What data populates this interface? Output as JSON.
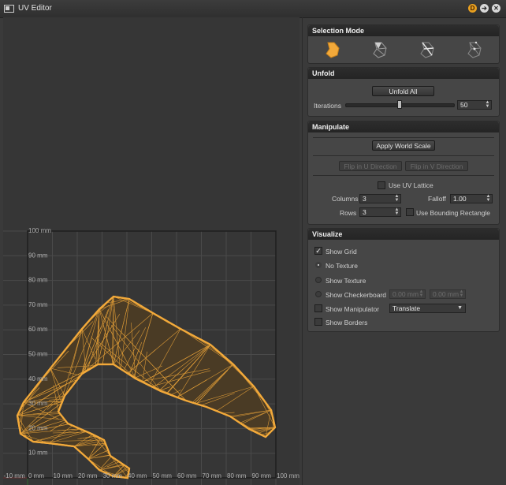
{
  "window": {
    "title": "UV Editor"
  },
  "viewport": {
    "unit": "mm",
    "y_labels": [
      "100 mm",
      "90 mm",
      "80 mm",
      "70 mm",
      "60 mm",
      "50 mm",
      "40 mm",
      "30 mm",
      "20 mm",
      "10 mm"
    ],
    "x_labels": [
      "-10 mm",
      "0 mm",
      "10 mm",
      "20 mm",
      "30 mm",
      "40 mm",
      "50 mm",
      "60 mm",
      "70 mm",
      "80 mm",
      "90 mm",
      "100 mm"
    ],
    "mesh_color": "#f2a93a"
  },
  "selection_mode": {
    "header": "Selection Mode",
    "modes": [
      {
        "name": "island",
        "icon": "island-select-icon",
        "active": true
      },
      {
        "name": "face",
        "icon": "face-select-icon",
        "active": false
      },
      {
        "name": "edge",
        "icon": "edge-select-icon",
        "active": false
      },
      {
        "name": "vertex",
        "icon": "vertex-select-icon",
        "active": false
      }
    ]
  },
  "unfold": {
    "header": "Unfold",
    "unfold_all_label": "Unfold All",
    "iterations_label": "Iterations",
    "iterations_value": "50",
    "iterations_slider_fraction": 0.5
  },
  "manipulate": {
    "header": "Manipulate",
    "apply_world_scale_label": "Apply World Scale",
    "flip_u_label": "Flip in U Direction",
    "flip_v_label": "Flip in V Direction",
    "use_uv_lattice_label": "Use UV Lattice",
    "use_uv_lattice_checked": false,
    "columns_label": "Columns",
    "columns_value": "3",
    "falloff_label": "Falloff",
    "falloff_value": "1.00",
    "rows_label": "Rows",
    "rows_value": "3",
    "use_bounding_rectangle_label": "Use Bounding Rectangle",
    "use_bounding_rectangle_checked": false
  },
  "visualize": {
    "header": "Visualize",
    "show_grid_label": "Show Grid",
    "show_grid_checked": true,
    "no_texture_label": "No Texture",
    "show_texture_label": "Show Texture",
    "show_checkerboard_label": "Show Checkerboard",
    "checker_u_value": "0.00 mm",
    "checker_v_value": "0.00 mm",
    "show_manipulator_label": "Show Manipulator",
    "manipulator_mode": "Translate",
    "show_borders_label": "Show Borders",
    "show_borders_checked": false
  }
}
